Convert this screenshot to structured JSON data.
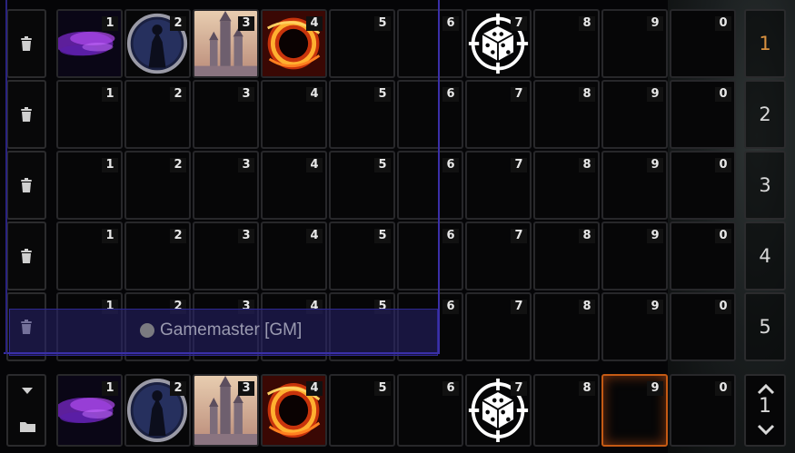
{
  "macro_directory": {
    "pages": [
      {
        "page_number": "1",
        "current": true,
        "slots": [
          {
            "key": "1",
            "icon": "purple-mist"
          },
          {
            "key": "2",
            "icon": "shadow-figure-portrait"
          },
          {
            "key": "3",
            "icon": "castle-tower"
          },
          {
            "key": "4",
            "icon": "fire-ring-vortex"
          },
          {
            "key": "5",
            "icon": ""
          },
          {
            "key": "6",
            "icon": ""
          },
          {
            "key": "7",
            "icon": "dice-target"
          },
          {
            "key": "8",
            "icon": ""
          },
          {
            "key": "9",
            "icon": ""
          },
          {
            "key": "0",
            "icon": ""
          }
        ]
      },
      {
        "page_number": "2",
        "current": false,
        "slots": [
          {
            "key": "1",
            "icon": ""
          },
          {
            "key": "2",
            "icon": ""
          },
          {
            "key": "3",
            "icon": ""
          },
          {
            "key": "4",
            "icon": ""
          },
          {
            "key": "5",
            "icon": ""
          },
          {
            "key": "6",
            "icon": ""
          },
          {
            "key": "7",
            "icon": ""
          },
          {
            "key": "8",
            "icon": ""
          },
          {
            "key": "9",
            "icon": ""
          },
          {
            "key": "0",
            "icon": ""
          }
        ]
      },
      {
        "page_number": "3",
        "current": false,
        "slots": [
          {
            "key": "1",
            "icon": ""
          },
          {
            "key": "2",
            "icon": ""
          },
          {
            "key": "3",
            "icon": ""
          },
          {
            "key": "4",
            "icon": ""
          },
          {
            "key": "5",
            "icon": ""
          },
          {
            "key": "6",
            "icon": ""
          },
          {
            "key": "7",
            "icon": ""
          },
          {
            "key": "8",
            "icon": ""
          },
          {
            "key": "9",
            "icon": ""
          },
          {
            "key": "0",
            "icon": ""
          }
        ]
      },
      {
        "page_number": "4",
        "current": false,
        "slots": [
          {
            "key": "1",
            "icon": ""
          },
          {
            "key": "2",
            "icon": ""
          },
          {
            "key": "3",
            "icon": ""
          },
          {
            "key": "4",
            "icon": ""
          },
          {
            "key": "5",
            "icon": ""
          },
          {
            "key": "6",
            "icon": ""
          },
          {
            "key": "7",
            "icon": ""
          },
          {
            "key": "8",
            "icon": ""
          },
          {
            "key": "9",
            "icon": ""
          },
          {
            "key": "0",
            "icon": ""
          }
        ]
      },
      {
        "page_number": "5",
        "current": false,
        "slots": [
          {
            "key": "1",
            "icon": ""
          },
          {
            "key": "2",
            "icon": ""
          },
          {
            "key": "3",
            "icon": ""
          },
          {
            "key": "4",
            "icon": ""
          },
          {
            "key": "5",
            "icon": ""
          },
          {
            "key": "6",
            "icon": ""
          },
          {
            "key": "7",
            "icon": ""
          },
          {
            "key": "8",
            "icon": ""
          },
          {
            "key": "9",
            "icon": ""
          },
          {
            "key": "0",
            "icon": ""
          }
        ]
      }
    ],
    "clear_icon": "trash-icon"
  },
  "player_list": {
    "player_name": "Gamemaster [GM]",
    "status_color": "#7a7a80"
  },
  "hotbar": {
    "page_number": "1",
    "active_key": "9",
    "slots": [
      {
        "key": "1",
        "icon": "purple-mist"
      },
      {
        "key": "2",
        "icon": "shadow-figure-portrait"
      },
      {
        "key": "3",
        "icon": "castle-tower"
      },
      {
        "key": "4",
        "icon": "fire-ring-vortex"
      },
      {
        "key": "5",
        "icon": ""
      },
      {
        "key": "6",
        "icon": ""
      },
      {
        "key": "7",
        "icon": "dice-target"
      },
      {
        "key": "8",
        "icon": ""
      },
      {
        "key": "9",
        "icon": ""
      },
      {
        "key": "0",
        "icon": ""
      }
    ],
    "accent_color": "#c45a14",
    "current_page_color": "#d9913f"
  }
}
